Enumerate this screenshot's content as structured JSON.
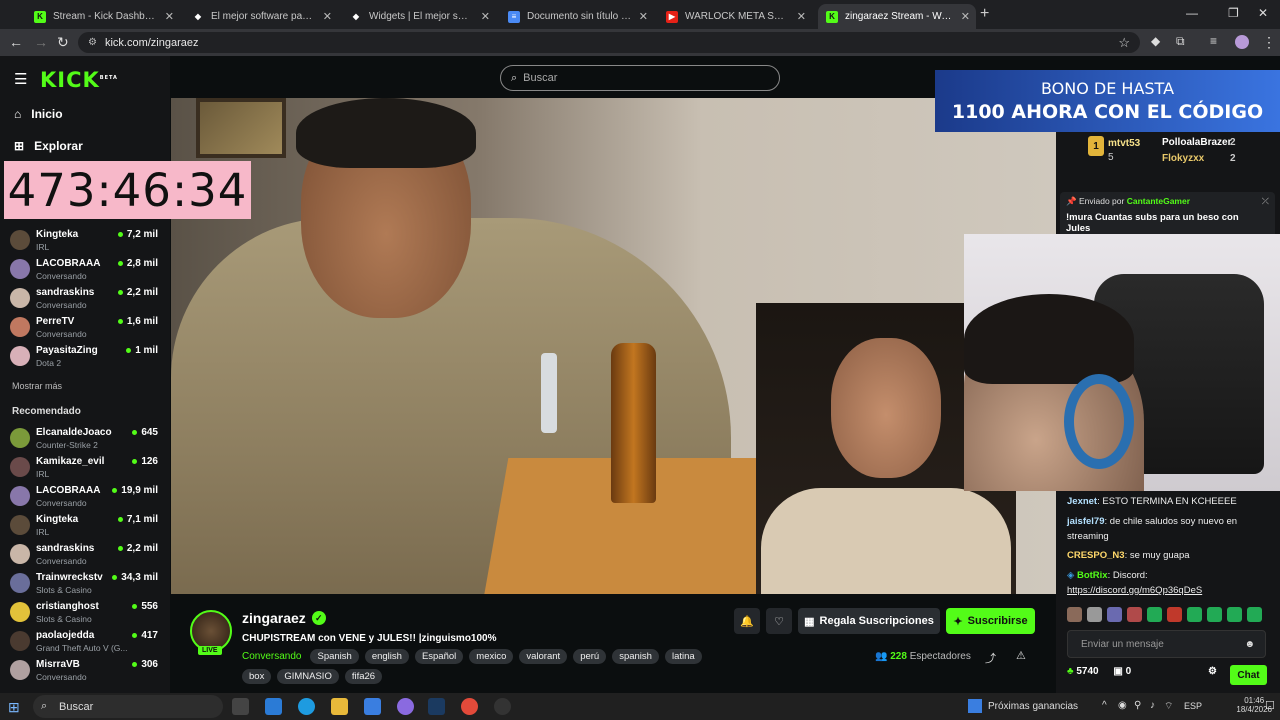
{
  "browser": {
    "tabs": [
      {
        "label": "Stream - Kick Dashboard",
        "icon": "kick-icon"
      },
      {
        "label": "El mejor software para potencia",
        "icon": "streamelements-icon"
      },
      {
        "label": "Widgets | El mejor software par",
        "icon": "streamelements-icon"
      },
      {
        "label": "Documento sin título - Docume",
        "icon": "docs-icon"
      },
      {
        "label": "WARLOCK META SUPPORT -",
        "icon": "youtube-icon"
      },
      {
        "label": "zingaraez Stream - Watch L",
        "icon": "kick-icon"
      }
    ],
    "url": "kick.com/zingaraez"
  },
  "sidebar": {
    "logo": "KICK",
    "logo_beta": "BETA",
    "nav": [
      {
        "label": "Inicio",
        "icon": "home-icon"
      },
      {
        "label": "Explorar",
        "icon": "compass-icon"
      }
    ],
    "timer": "473:46:34",
    "following": [
      {
        "name": "Kingteka",
        "category": "IRL",
        "viewers": "7,2 mil"
      },
      {
        "name": "LACOBRAAA",
        "category": "Conversando",
        "viewers": "2,8 mil"
      },
      {
        "name": "sandraskins",
        "category": "Conversando",
        "viewers": "2,2 mil"
      },
      {
        "name": "PerreTV",
        "category": "Conversando",
        "viewers": "1,6 mil"
      },
      {
        "name": "PayasitaZing",
        "category": "Dota 2",
        "viewers": "1 mil"
      }
    ],
    "show_more": "Mostrar más",
    "recommended_title": "Recomendado",
    "recommended": [
      {
        "name": "ElcanaldeJoaco",
        "category": "Counter-Strike 2",
        "viewers": "645"
      },
      {
        "name": "Kamikaze_evil",
        "category": "IRL",
        "viewers": "126"
      },
      {
        "name": "LACOBRAAA",
        "category": "Conversando",
        "viewers": "19,9 mil"
      },
      {
        "name": "Kingteka",
        "category": "IRL",
        "viewers": "7,1 mil"
      },
      {
        "name": "sandraskins",
        "category": "Conversando",
        "viewers": "2,2 mil"
      },
      {
        "name": "Trainwreckstv",
        "category": "Slots & Casino",
        "viewers": "34,3 mil"
      },
      {
        "name": "cristianghost",
        "category": "Slots & Casino",
        "viewers": "556"
      },
      {
        "name": "paolaojedda",
        "category": "Grand Theft Auto V (G...",
        "viewers": "417"
      },
      {
        "name": "MisrraVB",
        "category": "Conversando",
        "viewers": "306"
      }
    ]
  },
  "search": {
    "placeholder": "Buscar"
  },
  "banner": {
    "line1": "BONO DE HASTA",
    "line2": "1100 AHORA CON EL CÓDIGO"
  },
  "chat": {
    "leaders": [
      {
        "rank": "1",
        "name": "mtvt53",
        "count": "5"
      },
      {
        "name": "PolloalaBrazer",
        "count": "2"
      },
      {
        "name": "Flokyzxx",
        "count": "2"
      }
    ],
    "pinned": {
      "sent_by_label": "Enviado por",
      "sender": "CantanteGamer",
      "text": "!mura Cuantas subs para un beso con Jules"
    },
    "messages": [
      {
        "user": "Jexnet",
        "color": "#b4e1ff",
        "text": "ESTO TERMINA EN KCHEEEE"
      },
      {
        "user": "jaisfel79",
        "color": "#b4e1ff",
        "text": "de chile saludos soy nuevo en streaming"
      },
      {
        "user": "CRESPO_N3",
        "color": "#ffd86b",
        "text": "se muy guapa"
      },
      {
        "user": "BotRix",
        "color": "#53fc18",
        "text": "Discord:",
        "link": "https://discord.gg/m6Qp36qDeS"
      }
    ],
    "input_placeholder": "Enviar un mensaje",
    "points": "5740",
    "drops": "0",
    "chat_button": "Chat"
  },
  "stream": {
    "channel": "zingaraez",
    "live_label": "LIVE",
    "title": "CHUPISTREAM con VENE y JULES!! |zinguismo100%",
    "category": "Conversando",
    "tags": [
      "Spanish",
      "english",
      "Español",
      "mexico",
      "valorant",
      "perú",
      "spanish",
      "latina",
      "box",
      "GIMNASIO",
      "fifa26"
    ],
    "gift_label": "Regala Suscripciones",
    "subscribe_label": "Suscribirse",
    "viewers_count": "228",
    "viewers_label": "Espectadores"
  },
  "taskbar": {
    "search_label": "Buscar",
    "news": "Próximas ganancias",
    "lang": "ESP",
    "time": "01:46",
    "date": "18/4/2026"
  },
  "colors": {
    "kick_green": "#53fc18",
    "timer_bg": "#f7b8c9",
    "banner_blue": "#2a5bd0"
  }
}
